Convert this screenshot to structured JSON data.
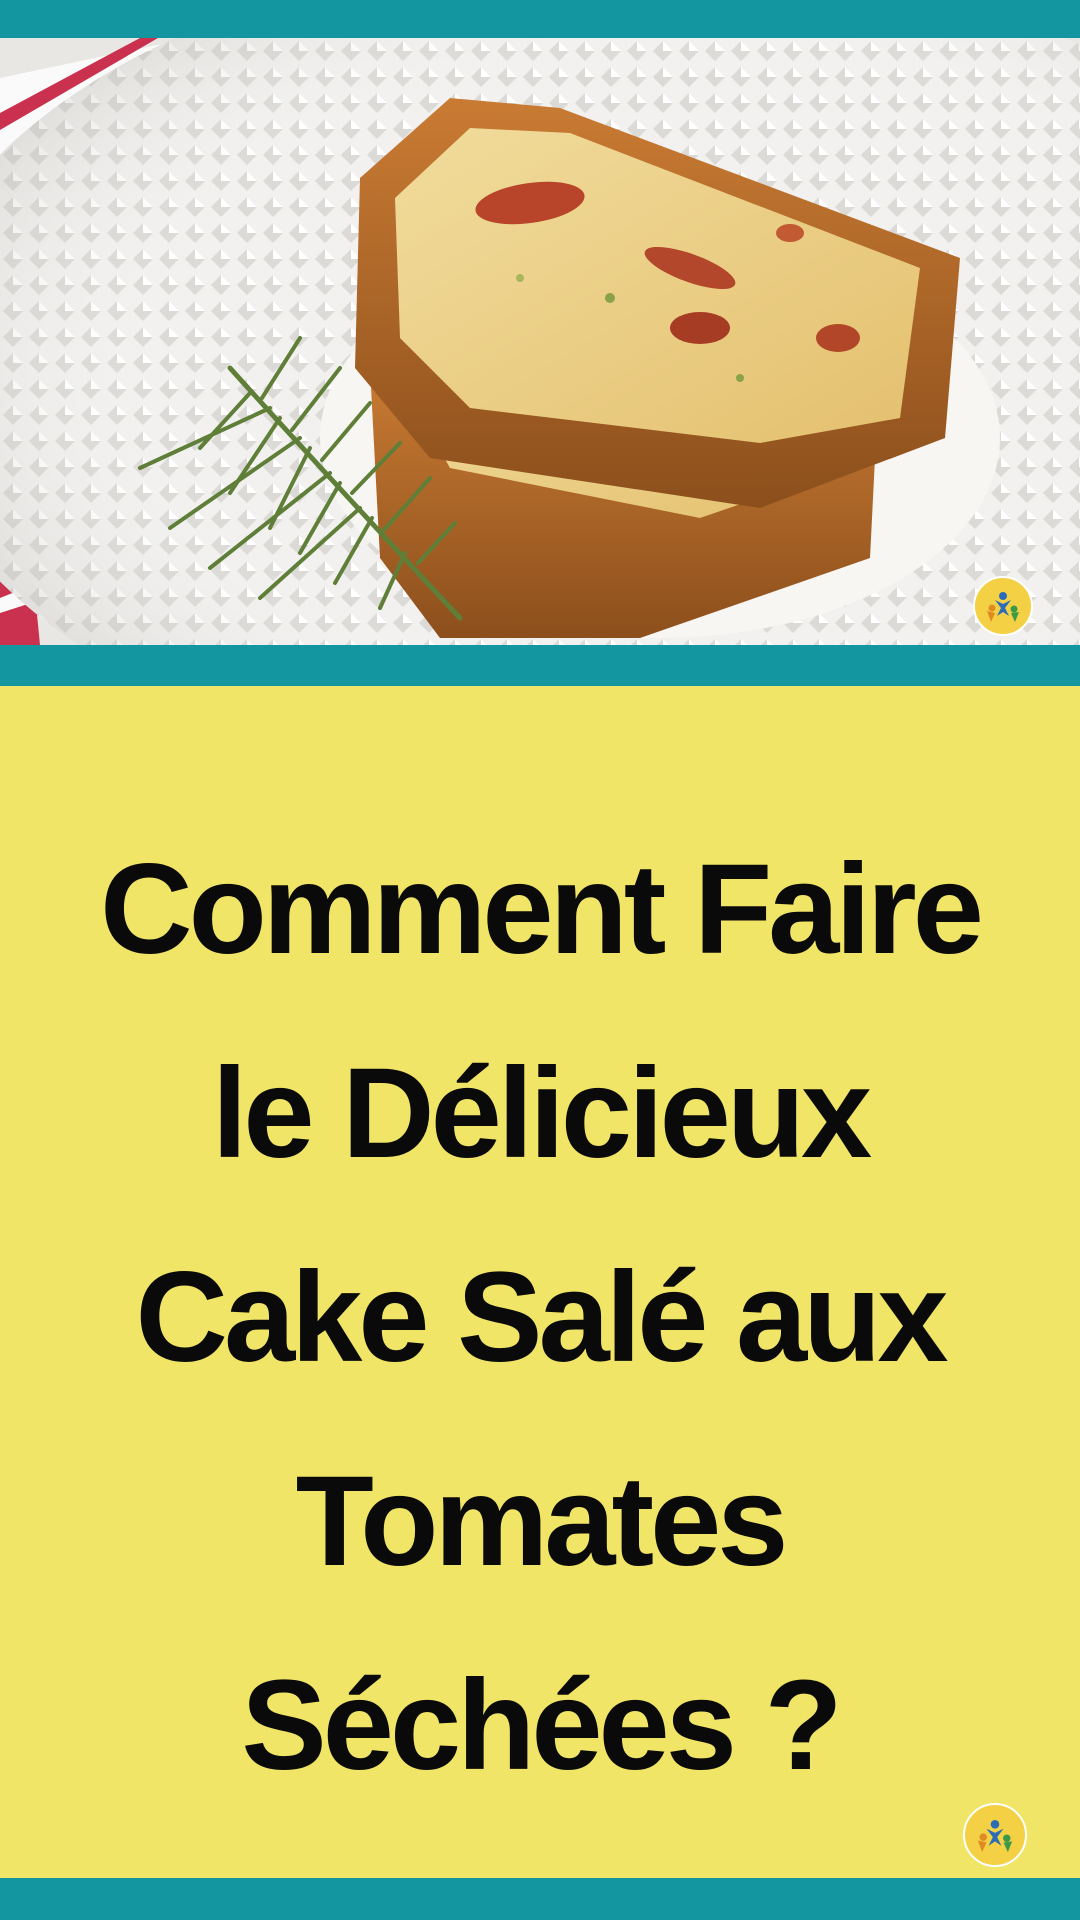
{
  "title_lines": [
    "Comment Faire",
    "le Délicieux",
    "Cake Salé aux",
    "Tomates",
    "Séchées ?"
  ],
  "colors": {
    "teal_band": "#13969f",
    "yellow_background": "#f0e566",
    "title_text": "#0a0a0a"
  },
  "image": {
    "subject": "slices of savory cake with sun-dried tomatoes on a white textured plate with rosemary sprig"
  },
  "icons": [
    "brand-logo-icon"
  ]
}
